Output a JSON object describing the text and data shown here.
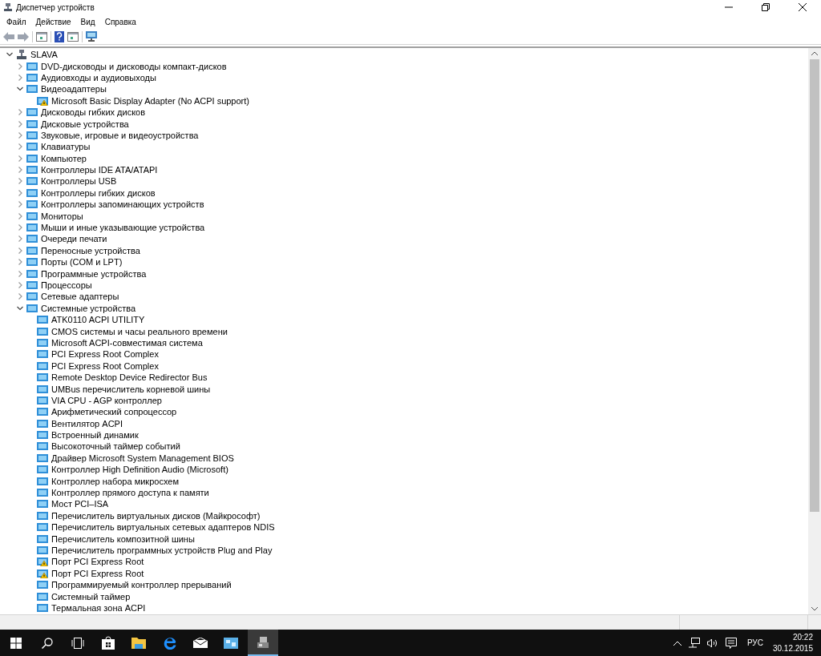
{
  "window": {
    "title": "Диспетчер устройств"
  },
  "menu": [
    "Файл",
    "Действие",
    "Вид",
    "Справка"
  ],
  "tree": {
    "label": "SLAVA",
    "expanded": true,
    "children": [
      {
        "label": "DVD-дисководы и дисководы компакт-дисков",
        "expanded": false
      },
      {
        "label": "Аудиовходы и аудиовыходы",
        "expanded": false
      },
      {
        "label": "Видеоадаптеры",
        "expanded": true,
        "children": [
          {
            "label": "Microsoft Basic Display Adapter (No ACPI support)",
            "warning": true
          }
        ]
      },
      {
        "label": "Дисководы гибких дисков",
        "expanded": false
      },
      {
        "label": "Дисковые устройства",
        "expanded": false
      },
      {
        "label": "Звуковые, игровые и видеоустройства",
        "expanded": false
      },
      {
        "label": "Клавиатуры",
        "expanded": false
      },
      {
        "label": "Компьютер",
        "expanded": false
      },
      {
        "label": "Контроллеры IDE ATA/ATAPI",
        "expanded": false
      },
      {
        "label": "Контроллеры USB",
        "expanded": false
      },
      {
        "label": "Контроллеры гибких дисков",
        "expanded": false
      },
      {
        "label": "Контроллеры запоминающих устройств",
        "expanded": false
      },
      {
        "label": "Мониторы",
        "expanded": false
      },
      {
        "label": "Мыши и иные указывающие устройства",
        "expanded": false
      },
      {
        "label": "Очереди печати",
        "expanded": false
      },
      {
        "label": "Переносные устройства",
        "expanded": false
      },
      {
        "label": "Порты (COM и LPT)",
        "expanded": false
      },
      {
        "label": "Программные устройства",
        "expanded": false
      },
      {
        "label": "Процессоры",
        "expanded": false
      },
      {
        "label": "Сетевые адаптеры",
        "expanded": false
      },
      {
        "label": "Системные устройства",
        "expanded": true,
        "children": [
          {
            "label": "ATK0110 ACPI UTILITY",
            "warning": false
          },
          {
            "label": "CMOS системы и часы реального времени",
            "warning": false
          },
          {
            "label": "Microsoft ACPI-совместимая система",
            "warning": false
          },
          {
            "label": "PCI Express Root Complex",
            "warning": false
          },
          {
            "label": "PCI Express Root Complex",
            "warning": false
          },
          {
            "label": "Remote Desktop Device Redirector Bus",
            "warning": false
          },
          {
            "label": "UMBus перечислитель корневой шины",
            "warning": false
          },
          {
            "label": "VIA CPU - AGP контроллер",
            "warning": false
          },
          {
            "label": "Арифметический сопроцессор",
            "warning": false
          },
          {
            "label": "Вентилятор ACPI",
            "warning": false
          },
          {
            "label": "Встроенный динамик",
            "warning": false
          },
          {
            "label": "Высокоточный таймер событий",
            "warning": false
          },
          {
            "label": "Драйвер Microsoft System Management BIOS",
            "warning": false
          },
          {
            "label": "Контроллер High Definition Audio (Microsoft)",
            "warning": false
          },
          {
            "label": "Контроллер набора микросхем",
            "warning": false
          },
          {
            "label": "Контроллер прямого доступа к памяти",
            "warning": false
          },
          {
            "label": "Мост PCI–ISA",
            "warning": false
          },
          {
            "label": "Перечислитель виртуальных дисков (Майкрософт)",
            "warning": false
          },
          {
            "label": "Перечислитель виртуальных сетевых адаптеров NDIS",
            "warning": false
          },
          {
            "label": "Перечислитель композитной шины",
            "warning": false
          },
          {
            "label": "Перечислитель программных устройств Plug and Play",
            "warning": false
          },
          {
            "label": "Порт PCI Express Root",
            "warning": true
          },
          {
            "label": "Порт PCI Express Root",
            "warning": true
          },
          {
            "label": "Программируемый контроллер прерываний",
            "warning": false
          },
          {
            "label": "Системный таймер",
            "warning": false
          },
          {
            "label": "Термальная зона ACPI",
            "warning": false
          }
        ]
      }
    ]
  },
  "taskbar": {
    "language": "РУС",
    "time": "20:22",
    "date": "30.12.2015"
  }
}
